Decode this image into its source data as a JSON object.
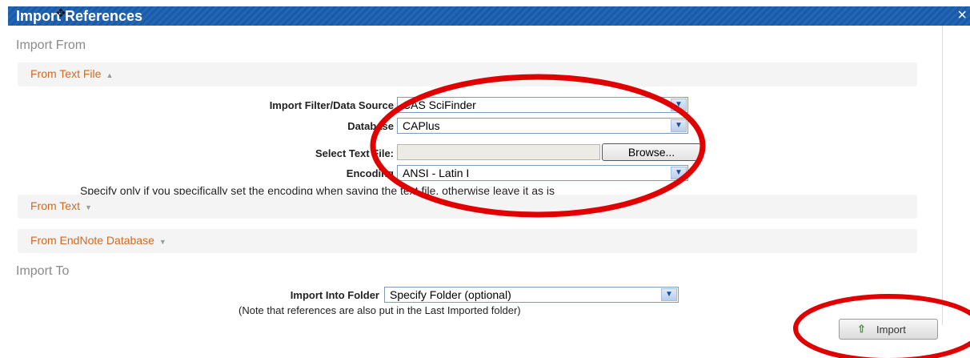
{
  "window": {
    "title": "Import References",
    "close_icon": "×"
  },
  "import_from": {
    "heading": "Import From",
    "from_text_file": {
      "label": "From Text File",
      "filter_label": "Import Filter/Data Source",
      "filter_value": "CAS SciFinder",
      "database_label": "Database",
      "database_value": "CAPlus",
      "select_file_label": "Select Text File:",
      "browse_label": "Browse...",
      "encoding_label": "Encoding",
      "encoding_value": "ANSI - Latin I",
      "encoding_note": "Specify only if you specifically set the encoding when saving the text file, otherwise leave it as is"
    },
    "from_text": {
      "label": "From Text"
    },
    "from_endnote": {
      "label": "From EndNote Database"
    }
  },
  "import_to": {
    "heading": "Import To",
    "folder_label": "Import Into Folder",
    "folder_value": "Specify Folder (optional)",
    "folder_note": "(Note that references are also put in the Last Imported folder)"
  },
  "import_button": {
    "label": "Import"
  },
  "colors": {
    "titlebar": "#1a5aa8",
    "accordion_label": "#d2691e",
    "annotation_circle": "#e00000"
  }
}
